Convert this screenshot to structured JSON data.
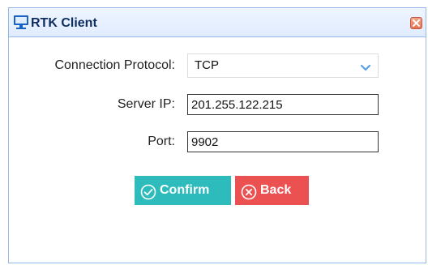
{
  "dialog": {
    "title": "RTK Client",
    "title_icon": "monitor-icon",
    "close_icon": "close-icon"
  },
  "form": {
    "protocol": {
      "label": "Connection Protocol:",
      "value": "TCP",
      "arrow_icon": "chevron-down-icon"
    },
    "server_ip": {
      "label": "Server IP:",
      "value": "201.255.122.215"
    },
    "port": {
      "label": "Port:",
      "value": "9902"
    }
  },
  "buttons": {
    "confirm": {
      "label": "Confirm",
      "icon": "check-circle-icon",
      "color": "#2dbbbb"
    },
    "back": {
      "label": "Back",
      "icon": "x-circle-icon",
      "color": "#ec5151"
    }
  },
  "colors": {
    "title_bar": "#e0ecff",
    "border": "#95b8e7",
    "title_text": "#0e2d5f"
  }
}
